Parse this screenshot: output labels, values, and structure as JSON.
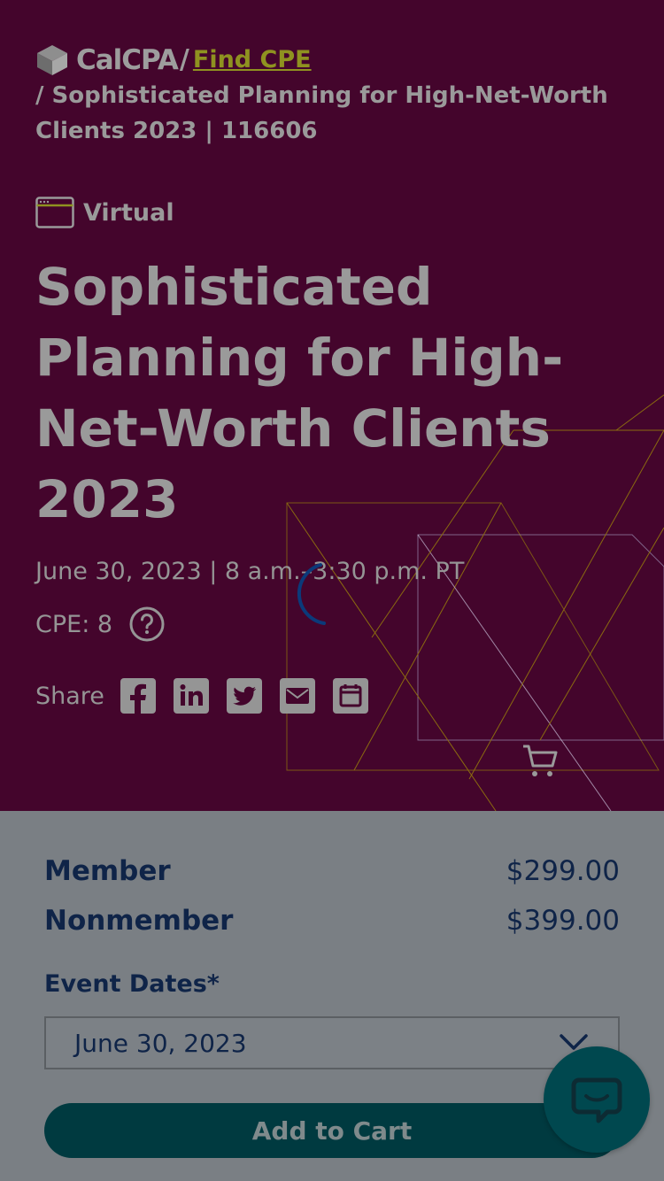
{
  "header": {
    "brand": "CalCPA",
    "separator": "/",
    "crumb_link": "Find CPE",
    "crumb_current": "/ Sophisticated Planning for High-Net-Worth Clients 2023 | 116606"
  },
  "event": {
    "format": "Virtual",
    "title": "Sophisticated Planning for High-Net-Worth Clients 2023",
    "date_time": "June 30, 2023 | 8 a.m.–3:30 p.m. PT",
    "cpe": "CPE: 8",
    "share_label": "Share",
    "share_icons": [
      "facebook-icon",
      "linkedin-icon",
      "twitter-icon",
      "email-icon",
      "calendar-icon"
    ]
  },
  "pricing": {
    "member_label": "Member",
    "member_price": "$299.00",
    "nonmember_label": "Nonmember",
    "nonmember_price": "$399.00"
  },
  "form": {
    "event_dates_label": "Event Dates*",
    "event_dates_selected": "June 30, 2023",
    "add_to_cart_label": "Add to Cart"
  },
  "colors": {
    "hero_bg": "#44052c",
    "link": "#8f9220",
    "price_text": "#0f2448",
    "button_bg": "#003a40"
  }
}
